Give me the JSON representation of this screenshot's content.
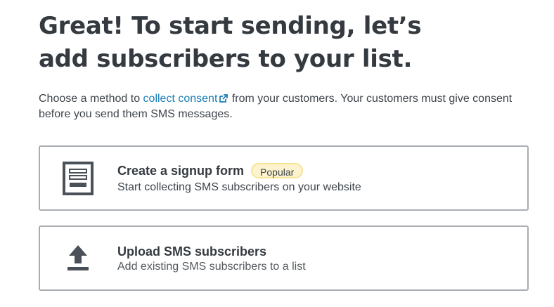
{
  "heading": {
    "title": "Great! To start sending, let’s add subscribers to your list."
  },
  "intro": {
    "before_link": "Choose a method to ",
    "link_text": "collect consent",
    "link_icon": "external-link-icon",
    "after_link": " from your customers. Your customers must give consent before you send them SMS messages."
  },
  "options": [
    {
      "icon": "form-icon",
      "title": "Create a signup form",
      "badge": "Popular",
      "description": "Start collecting SMS subscribers on your website"
    },
    {
      "icon": "upload-icon",
      "title": "Upload SMS subscribers",
      "description": "Add existing SMS subscribers to a list"
    }
  ],
  "colors": {
    "link": "#1a7fb5",
    "badge_background": "#fdf4cf",
    "badge_border": "#f7e596",
    "card_border": "#a9adb1",
    "icon": "#4a5158"
  }
}
